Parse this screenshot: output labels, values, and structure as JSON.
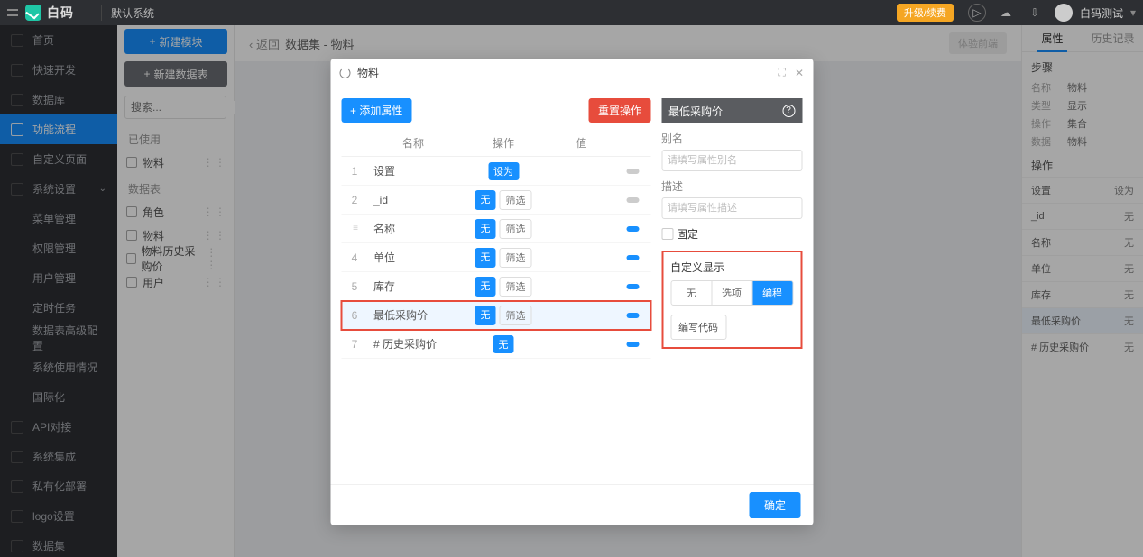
{
  "topbar": {
    "brand": "白码",
    "system": "默认系统",
    "orange_button": "升级/续费",
    "user_name": "白码测试"
  },
  "leftnav": {
    "items": [
      {
        "label": "首页"
      },
      {
        "label": "快速开发"
      },
      {
        "label": "数据库"
      },
      {
        "label": "功能流程",
        "active": true
      },
      {
        "label": "自定义页面"
      },
      {
        "label": "系统设置",
        "expandable": true
      }
    ],
    "sys_children": [
      "菜单管理",
      "权限管理",
      "用户管理",
      "定时任务",
      "数据表高级配置",
      "系统使用情况",
      "国际化"
    ],
    "tail": [
      "API对接",
      "系统集成",
      "私有化部署",
      "logo设置",
      "数据集"
    ]
  },
  "panel2": {
    "back": "返回",
    "title": "数据集 - 物料",
    "btn_blue": "新建模块",
    "btn_grey": "新建数据表",
    "search_placeholder": "搜索...",
    "used_label": "已使用",
    "used_items": [
      "物料"
    ],
    "tables_label": "数据表",
    "tables": [
      "角色",
      "物料",
      "物料历史采购价",
      "用户"
    ]
  },
  "mainbar": {
    "back": "返回",
    "title": "数据集 - 物料",
    "btn": "体验前端"
  },
  "rightpanel": {
    "tab_attr": "属性",
    "tab_history": "历史记录",
    "section_step": "步骤",
    "kv": [
      {
        "k": "名称",
        "v": "物料"
      },
      {
        "k": "类型",
        "v": "显示"
      },
      {
        "k": "操作",
        "v": "集合"
      },
      {
        "k": "数据",
        "v": "物料"
      }
    ],
    "section_op": "操作",
    "ops": [
      {
        "name": "设置",
        "val": "设为"
      },
      {
        "name": "_id",
        "val": "无"
      },
      {
        "name": "名称",
        "val": "无"
      },
      {
        "name": "单位",
        "val": "无"
      },
      {
        "name": "库存",
        "val": "无"
      },
      {
        "name": "最低采购价",
        "val": "无"
      },
      {
        "name": "# 历史采购价",
        "val": "无"
      }
    ]
  },
  "modal": {
    "title": "物料",
    "add_attr": "+  添加属性",
    "reset_op": "重置操作",
    "hdr_name": "名称",
    "hdr_op": "操作",
    "hdr_val": "值",
    "rows": [
      {
        "idx": "1",
        "name": "设置",
        "op1": "设为",
        "op2": "",
        "dash": false
      },
      {
        "idx": "2",
        "name": "_id",
        "op1": "无",
        "op2": "筛选",
        "dash": false
      },
      {
        "idx": "≡",
        "name": "名称",
        "op1": "无",
        "op2": "筛选",
        "dash": true,
        "drag": true
      },
      {
        "idx": "4",
        "name": "单位",
        "op1": "无",
        "op2": "筛选",
        "dash": true
      },
      {
        "idx": "5",
        "name": "库存",
        "op1": "无",
        "op2": "筛选",
        "dash": true
      },
      {
        "idx": "6",
        "name": "最低采购价",
        "op1": "无",
        "op2": "筛选",
        "dash": true,
        "highlight": true
      },
      {
        "idx": "7",
        "name": "# 历史采购价",
        "op1": "无",
        "op2": "",
        "dash": true
      }
    ],
    "ok": "确定",
    "right": {
      "title": "最低采购价",
      "alias_label": "别名",
      "alias_ph": "请填写属性别名",
      "desc_label": "描述",
      "desc_ph": "请填写属性描述",
      "fixed": "固定",
      "custom_label": "自定义显示",
      "seg": [
        "无",
        "选项",
        "编程"
      ],
      "code": "编写代码"
    }
  }
}
